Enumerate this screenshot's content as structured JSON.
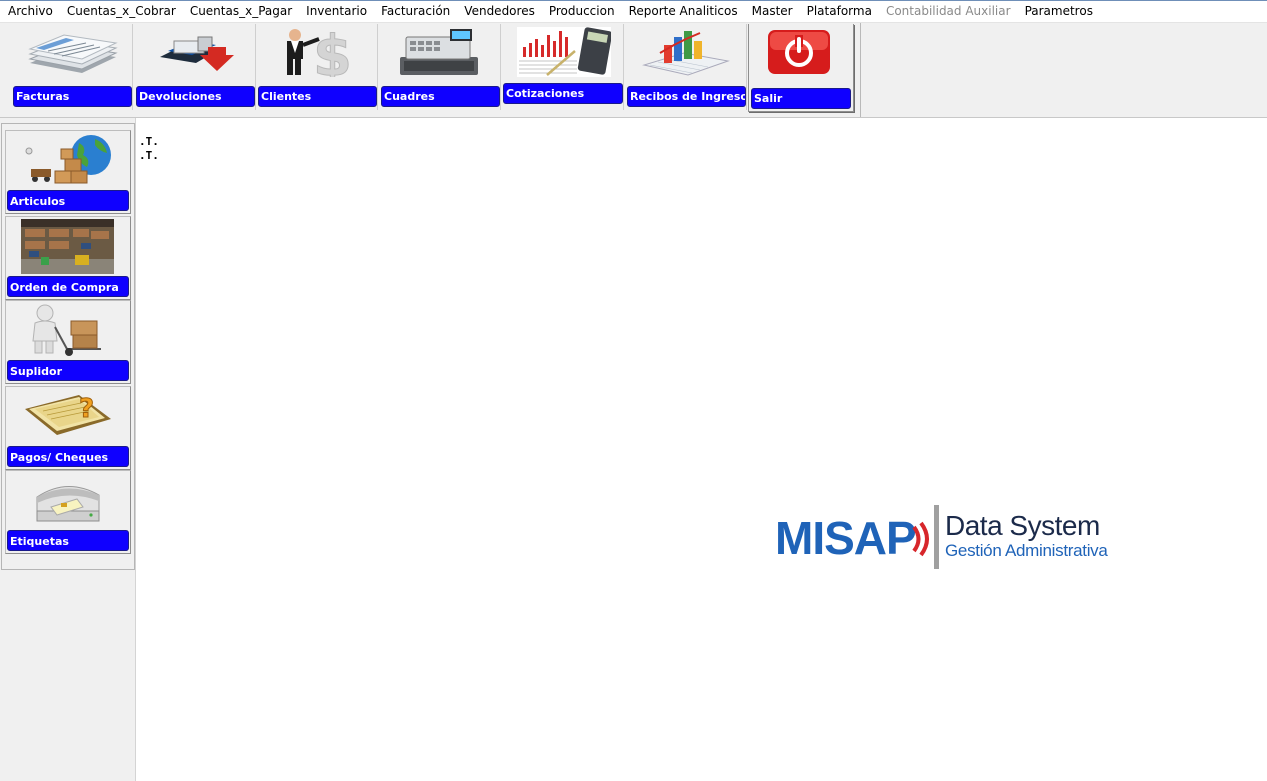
{
  "menu": [
    {
      "label": "Archivo",
      "enabled": true
    },
    {
      "label": "Cuentas_x_Cobrar",
      "enabled": true
    },
    {
      "label": "Cuentas_x_Pagar",
      "enabled": true
    },
    {
      "label": "Inventario",
      "enabled": true
    },
    {
      "label": "Facturación",
      "enabled": true
    },
    {
      "label": "Vendedores",
      "enabled": true
    },
    {
      "label": "Produccion",
      "enabled": true
    },
    {
      "label": "Reporte Analiticos",
      "enabled": true
    },
    {
      "label": "Master",
      "enabled": true
    },
    {
      "label": "Plataforma",
      "enabled": true
    },
    {
      "label": "Contabilidad Auxiliar",
      "enabled": false
    },
    {
      "label": "Parametros",
      "enabled": true
    }
  ],
  "toolbar": {
    "facturas": "Facturas",
    "devoluciones": "Devoluciones",
    "clientes": "Clientes",
    "cuadres": "Cuadres",
    "cotizaciones": "Cotizaciones",
    "recibos": "Recibos de Ingresos",
    "salir": "Salir"
  },
  "sidebar": {
    "articulos": "Articulos",
    "orden_compra": "Orden de Compra",
    "suplidor": "Suplidor",
    "pagos": "Pagos/ Cheques",
    "etiquetas": "Etiquetas"
  },
  "main": {
    "mark1": ".T.",
    "mark2": ".T."
  },
  "logo": {
    "brand_left": "MISAP",
    "title": "Data System",
    "subtitle": "Gestión Administrativa"
  },
  "colors": {
    "label_blue": "#0f00ff",
    "brand_blue": "#1f63b8",
    "brand_red": "#d7262b",
    "power_red": "#e22020"
  }
}
